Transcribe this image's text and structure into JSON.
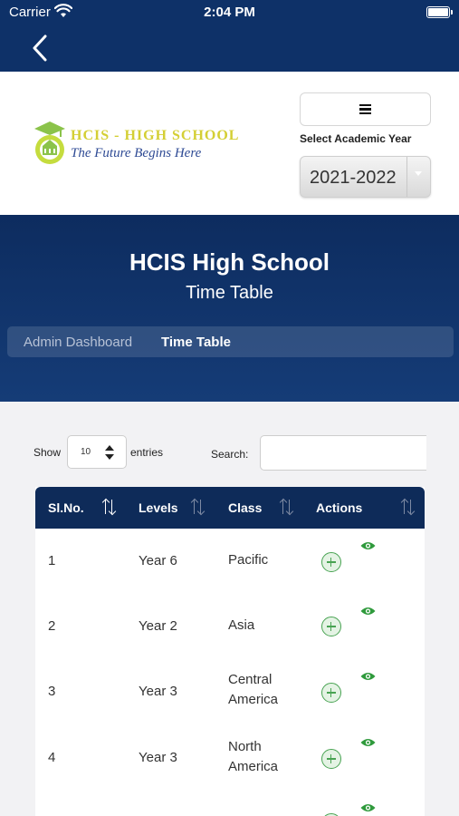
{
  "status_bar": {
    "carrier": "Carrier",
    "time": "2:04 PM"
  },
  "logo": {
    "school_name": "HCIS - HIGH SCHOOL",
    "tagline": "The Future Begins Here"
  },
  "year_selector": {
    "label": "Select Academic Year",
    "value": "2021-2022"
  },
  "hero": {
    "title": "HCIS High School",
    "subtitle": "Time Table"
  },
  "breadcrumb": {
    "items": [
      "Admin Dashboard",
      "Time Table"
    ]
  },
  "table_controls": {
    "show_label": "Show",
    "entries_value": "10",
    "entries_label": "entries",
    "search_label": "Search:",
    "search_value": ""
  },
  "table": {
    "columns": [
      "Sl.No.",
      "Levels",
      "Class",
      "Actions"
    ],
    "rows": [
      {
        "sl": "1",
        "level": "Year 6",
        "class": "Pacific"
      },
      {
        "sl": "2",
        "level": "Year 2",
        "class": "Asia"
      },
      {
        "sl": "3",
        "level": "Year 3",
        "class": "Central America"
      },
      {
        "sl": "4",
        "level": "Year 3",
        "class": "North America"
      },
      {
        "sl": "",
        "level": "",
        "class": ""
      }
    ]
  },
  "icons": [
    "back-chevron-icon",
    "wifi-icon",
    "battery-icon",
    "hamburger-menu-icon",
    "sort-icon",
    "add-circle-icon",
    "eye-icon",
    "school-crest-icon"
  ],
  "colors": {
    "nav": "#0e3168",
    "table_header": "#0e2b59",
    "action_green": "#48a352",
    "logo_yellow": "#d4cf34",
    "logo_blue": "#2e4a94"
  }
}
